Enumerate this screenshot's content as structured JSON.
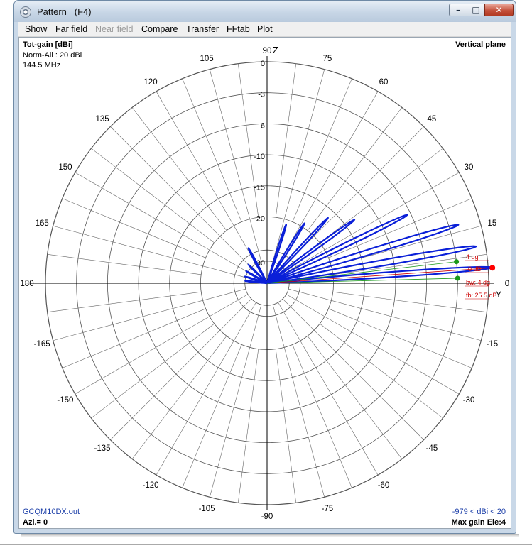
{
  "window": {
    "title": "Pattern   (F4)",
    "controls": {
      "minimize": "–",
      "maximize": "□",
      "close": "✕"
    }
  },
  "menu": [
    {
      "label": "Show",
      "enabled": true
    },
    {
      "label": "Far field",
      "enabled": true
    },
    {
      "label": "Near field",
      "enabled": false
    },
    {
      "label": "Compare",
      "enabled": true
    },
    {
      "label": "Transfer",
      "enabled": true
    },
    {
      "label": "FFtab",
      "enabled": true
    },
    {
      "label": "Plot",
      "enabled": true
    }
  ],
  "plot": {
    "header_left": [
      "Tot-gain [dBi]",
      "Norm-All : 20 dBi",
      "144.5 MHz"
    ],
    "header_right": "Vertical plane",
    "z_axis_label": "Z",
    "y_axis_label": "Y",
    "footer_left_file": "GCQM10DX.out",
    "footer_left_azi": "Azi.= 0",
    "footer_right_range": "-979 < dBi < 20",
    "footer_right_max": "Max gain Ele:4",
    "angle_labels": [
      "90",
      "75",
      "60",
      "45",
      "30",
      "15",
      "0",
      "-15",
      "-30",
      "-45",
      "-60",
      "-75",
      "-90",
      "-105",
      "-120",
      "-135",
      "-150",
      "-165",
      "180",
      "165",
      "150",
      "135",
      "120",
      "105"
    ],
    "ring_labels": [
      "0",
      "-3",
      "-6",
      "-10",
      "-15",
      "-20",
      "-30"
    ],
    "annotations": {
      "beam_upper": "4 dg",
      "beam_peak": "0 dB",
      "bw": "bw: 4 dg",
      "fb": "fb: 25.5 dB"
    },
    "colors": {
      "pattern": "#0a1fd8",
      "annotation": "#cc0000",
      "grid": "#000000",
      "marker_green": "#1a9a1a",
      "marker_red": "#ff0000"
    }
  },
  "chart_data": {
    "type": "polar",
    "title": "",
    "radial_axis": {
      "label": "Tot-gain [dBi]",
      "ticks_db": [
        0,
        -3,
        -6,
        -10,
        -15,
        -20,
        -30
      ],
      "normalization_dbi": 20
    },
    "angular_axis_deg": [
      90,
      75,
      60,
      45,
      30,
      15,
      0,
      -15,
      -30,
      -45,
      -60,
      -75,
      -90,
      -105,
      -120,
      -135,
      -150,
      -165,
      180,
      165,
      150,
      135,
      120,
      105
    ],
    "frequency": "144.5 MHz",
    "plane": "Vertical plane",
    "max_gain_elevation_deg": 4,
    "beamwidth_deg": 4,
    "front_to_back_db": 25.5,
    "series": [
      {
        "lobes": [
          {
            "elev_deg": 4,
            "gain_db": 0
          },
          {
            "elev_deg": 10,
            "gain_db": -1.3
          },
          {
            "elev_deg": 17,
            "gain_db": -2.5
          },
          {
            "elev_deg": 26,
            "gain_db": -7
          },
          {
            "elev_deg": 36,
            "gain_db": -14
          },
          {
            "elev_deg": 47,
            "gain_db": -17
          },
          {
            "elev_deg": 58,
            "gain_db": -20
          },
          {
            "elev_deg": 72,
            "gain_db": -22
          },
          {
            "elev_deg": 118,
            "gain_db": -27
          },
          {
            "elev_deg": 135,
            "gain_db": -30
          },
          {
            "elev_deg": 150,
            "gain_db": -32
          },
          {
            "elev_deg": 163,
            "gain_db": -33
          },
          {
            "elev_deg": 174,
            "gain_db": -34
          }
        ]
      }
    ]
  }
}
